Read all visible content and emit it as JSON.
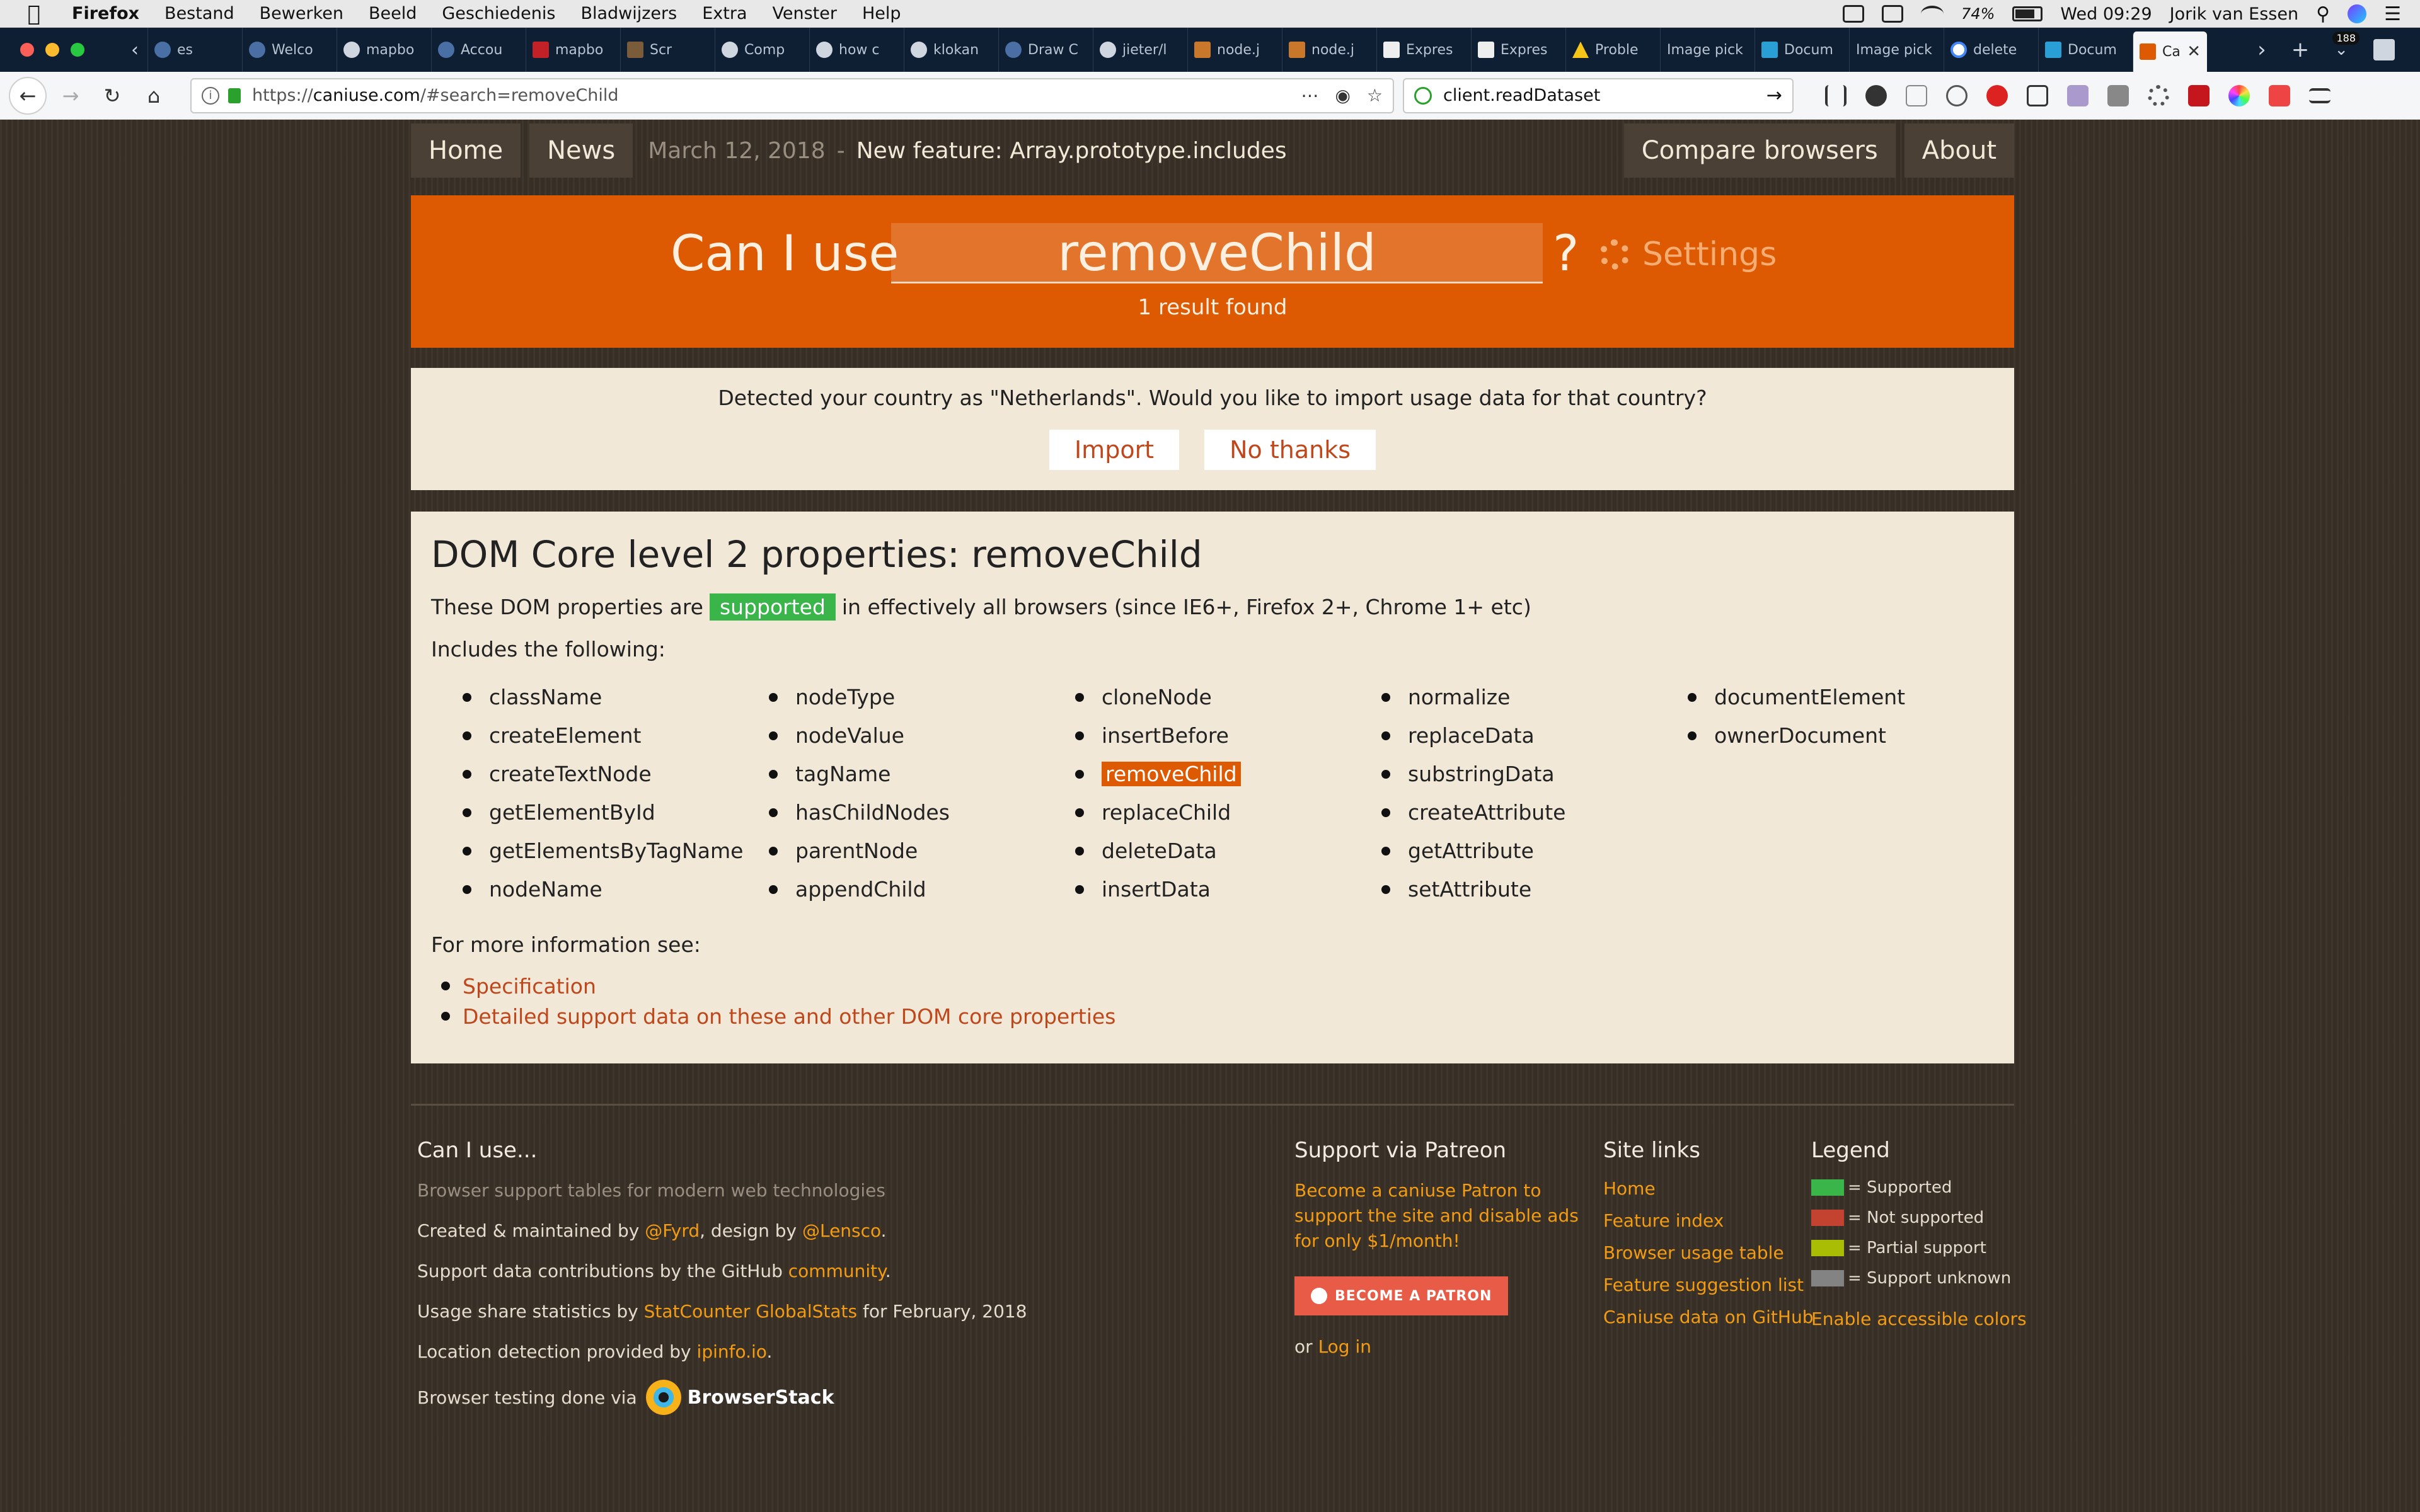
{
  "menubar": {
    "app": "Firefox",
    "items": [
      "Bestand",
      "Bewerken",
      "Beeld",
      "Geschiedenis",
      "Bladwijzers",
      "Extra",
      "Venster",
      "Help"
    ],
    "battery": "74%",
    "clock": "Wed 09:29",
    "user": "Jorik van Essen"
  },
  "tabs": [
    {
      "label": "es",
      "icon": "page-icon"
    },
    {
      "label": "Welco",
      "icon": "firefox-icon"
    },
    {
      "label": "mapbo",
      "icon": "github-icon"
    },
    {
      "label": "Accou",
      "icon": "firefox-icon"
    },
    {
      "label": "mapbo",
      "icon": "npm-icon"
    },
    {
      "label": "Scr",
      "icon": "page-icon"
    },
    {
      "label": "Comp",
      "icon": "github-icon"
    },
    {
      "label": "how c",
      "icon": "github-icon"
    },
    {
      "label": "klokan",
      "icon": "github-icon"
    },
    {
      "label": "Draw C",
      "icon": "firefox-icon"
    },
    {
      "label": "jieter/l",
      "icon": "github-icon"
    },
    {
      "label": "node.j",
      "icon": "page-icon"
    },
    {
      "label": "node.j",
      "icon": "page-icon"
    },
    {
      "label": "Expres",
      "icon": "express-icon"
    },
    {
      "label": "Expres",
      "icon": "express-icon"
    },
    {
      "label": "Proble",
      "icon": "warning-icon"
    },
    {
      "label": "Image pick",
      "icon": ""
    },
    {
      "label": "Docum",
      "icon": "docs-icon"
    },
    {
      "label": "Image pick",
      "icon": ""
    },
    {
      "label": "delete",
      "icon": "google-icon"
    },
    {
      "label": "Docum",
      "icon": "docs-icon"
    }
  ],
  "active_tab": {
    "label": "Ca"
  },
  "tab_badge": "188",
  "navbar": {
    "url_scheme": "https://",
    "url_host": "caniuse.com",
    "url_path": "/#search=removeChild",
    "search_value": "client.readDataset"
  },
  "topnav": {
    "home": "Home",
    "news": "News",
    "news_date": "March 12, 2018",
    "news_sep": "-",
    "news_title": "New feature: Array.prototype.includes",
    "compare": "Compare browsers",
    "about": "About"
  },
  "search": {
    "prefix": "Can I use",
    "value": "removeChild",
    "suffix": "?",
    "settings": "Settings",
    "results": "1 result found"
  },
  "import": {
    "message": "Detected your country as \"Netherlands\". Would you like to import usage data for that country?",
    "import_label": "Import",
    "decline_label": "No thanks"
  },
  "feature": {
    "title": "DOM Core level 2 properties: removeChild",
    "desc_before": "These DOM properties are",
    "status": "supported",
    "desc_after": "in effectively all browsers (since IE6+, Firefox 2+, Chrome 1+ etc)",
    "includes_label": "Includes the following:",
    "columns": [
      [
        "className",
        "createElement",
        "createTextNode",
        "getElementById",
        "getElementsByTagName",
        "nodeName"
      ],
      [
        "nodeType",
        "nodeValue",
        "tagName",
        "hasChildNodes",
        "parentNode",
        "appendChild"
      ],
      [
        "cloneNode",
        "insertBefore",
        "removeChild",
        "replaceChild",
        "deleteData",
        "insertData"
      ],
      [
        "normalize",
        "replaceData",
        "substringData",
        "createAttribute",
        "getAttribute",
        "setAttribute"
      ],
      [
        "documentElement",
        "ownerDocument"
      ]
    ],
    "highlight": "removeChild",
    "more_label": "For more information see:",
    "links": [
      "Specification",
      "Detailed support data on these and other DOM core properties"
    ]
  },
  "footer": {
    "c1": {
      "title": "Can I use...",
      "tagline": "Browser support tables for modern web technologies",
      "created_pre": "Created & maintained by",
      "created_author": "@Fyrd",
      "created_mid": ", design by",
      "created_designer": "@Lensco",
      "created_end": ".",
      "contrib_pre": "Support data contributions by the GitHub",
      "contrib_link": "community",
      "contrib_end": ".",
      "usage_pre": "Usage share statistics by",
      "usage_link": "StatCounter GlobalStats",
      "usage_end": "for February, 2018",
      "loc_pre": "Location detection provided by",
      "loc_link": "ipinfo.io",
      "loc_end": ".",
      "testing_pre": "Browser testing done via",
      "testing_brand": "BrowserStack"
    },
    "c2": {
      "title": "Support via Patreon",
      "text": "Become a caniuse Patron to support the site and disable ads for only $1/month!",
      "button": "BECOME A PATRON",
      "or": "or",
      "login": "Log in"
    },
    "c3": {
      "title": "Site links",
      "links": [
        "Home",
        "Feature index",
        "Browser usage table",
        "Feature suggestion list",
        "Caniuse data on GitHub"
      ]
    },
    "c4": {
      "title": "Legend",
      "items": [
        {
          "label": "= Supported",
          "color": "#39b54a"
        },
        {
          "label": "= Not supported",
          "color": "#c44230"
        },
        {
          "label": "= Partial support",
          "color": "#a8bd04"
        },
        {
          "label": "= Support unknown",
          "color": "#838383"
        }
      ],
      "accessible": "Enable accessible colors"
    }
  },
  "colors": {
    "accent_orange": "#dd5a03",
    "supported_green": "#39b54a",
    "link_orange": "#f39c12"
  }
}
